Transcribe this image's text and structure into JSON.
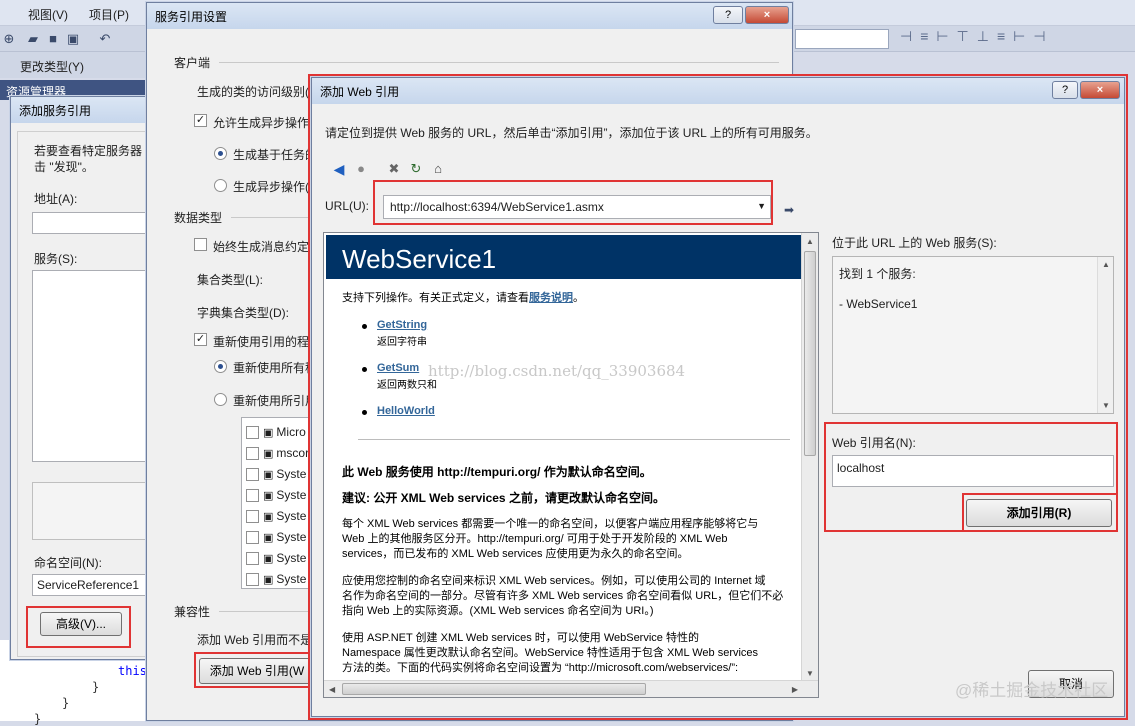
{
  "vs": {
    "menu": [
      "视图(V)",
      "项目(P)"
    ],
    "toolbar_label": "更改类型(Y)",
    "panel_title": "资源管理器",
    "code_lines": [
      "this",
      "}",
      "}",
      "}"
    ]
  },
  "add_service_dialog": {
    "title": "添加服务引用",
    "hint_line1": "若要查看特定服务器",
    "hint_line2": "击 \"发现\"。",
    "address_label": "地址(A):",
    "services_label": "服务(S):",
    "namespace_label": "命名空间(N):",
    "namespace_value": "ServiceReference1",
    "advanced_button": "高级(V)..."
  },
  "settings_dialog": {
    "title": "服务引用设置",
    "client_section": "客户端",
    "access_level_label": "生成的类的访问级别(",
    "allow_async_label": "允许生成异步操作",
    "task_based_label": "生成基于任务的",
    "async_ops_label": "生成异步操作(",
    "data_type_section": "数据类型",
    "always_gen_label": "始终生成消息约定",
    "collection_type_label": "集合类型(L):",
    "dict_type_label": "字典集合类型(D):",
    "reuse_label": "重新使用引用的程",
    "reuse_all_label": "重新使用所有程",
    "reuse_selected_label": "重新使用所引用",
    "assemblies": [
      "Micro",
      "mscor",
      "Syste",
      "Syste",
      "Syste",
      "Syste",
      "Syste",
      "Syste"
    ],
    "compat_section": "兼容性",
    "add_web_ref_hint": "添加 Web 引用而不是",
    "add_web_ref_button": "添加 Web 引用(W"
  },
  "web_ref_dialog": {
    "title": "添加 Web 引用",
    "help_button": "?",
    "close_button": "×",
    "instruction": "请定位到提供 Web 服务的 URL，然后单击“添加引用”，添加位于该 URL 上的所有可用服务。",
    "url_label": "URL(U):",
    "url_value": "http://localhost:6394/WebService1.asmx",
    "services_at_url_label": "位于此 URL 上的 Web 服务(S):",
    "found_text": "找到 1 个服务:",
    "service_item": "- WebService1",
    "ref_name_label": "Web 引用名(N):",
    "ref_name_value": "localhost",
    "add_ref_button": "添加引用(R)",
    "cancel_button": "取消"
  },
  "web_page": {
    "title": "WebService1",
    "intro": "支持下列操作。有关正式定义，请查看",
    "intro_link": "服务说明",
    "intro_end": "。",
    "operations": [
      {
        "name": "GetString",
        "desc": "返回字符串"
      },
      {
        "name": "GetSum",
        "desc": "返回两数只和"
      },
      {
        "name": "HelloWorld",
        "desc": ""
      }
    ],
    "ns_heading": "此 Web 服务使用 http://tempuri.org/ 作为默认命名空间。",
    "advice_heading": "建议: 公开 XML Web services 之前，请更改默认命名空间。",
    "para1": [
      "每个 XML Web services 都需要一个唯一的命名空间，以便客户端应用程序能够将它与",
      "Web 上的其他服务区分开。http://tempuri.org/ 可用于处于开发阶段的 XML Web",
      "services，而已发布的 XML Web services 应使用更为永久的命名空间。"
    ],
    "para2": [
      "应使用您控制的命名空间来标识 XML Web services。例如，可以使用公司的 Internet 域",
      "名作为命名空间的一部分。尽管有许多 XML Web services 命名空间看似 URL，但它们不必",
      "指向 Web 上的实际资源。(XML Web services 命名空间为 URI。)"
    ],
    "para3": [
      "使用 ASP.NET 创建 XML Web services 时，可以使用 WebService 特性的",
      "Namespace 属性更改默认命名空间。WebService 特性适用于包含 XML Web services",
      "方法的类。下面的代码实例将命名空间设置为 “http://microsoft.com/webservices/”:"
    ]
  },
  "overlays": {
    "watermark": "http://blog.csdn.net/qq_33903684",
    "corner_watermark": "@稀土掘金技术社区"
  }
}
